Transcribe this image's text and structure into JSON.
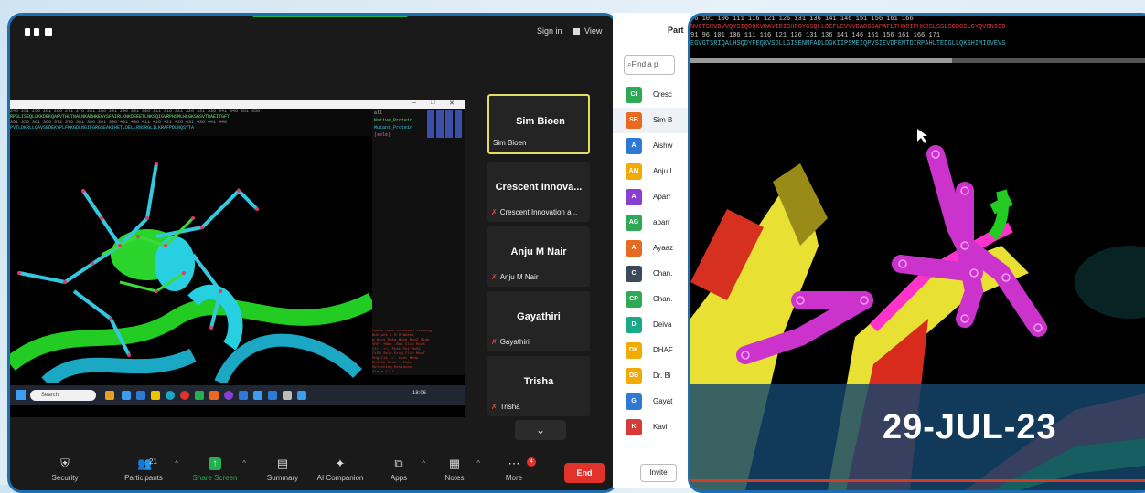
{
  "topbar": {
    "sign_in": "Sign in",
    "view": "View"
  },
  "shared_screen": {
    "seq_lines": [
      "246 251 256 261 266 271 276 281 286 291 296 301 306 311 316 321 326 331 336 341 346 351 356",
      "RPSLISEQLLKKDEKQAFVTHLTNALNKARHKEGYSFAIRLKNKDEEETLNKSQIGVRPHSMLHLGKSGSVTRAEITGFT",
      "351 356 361 366 371 376 381 386 391 396 401 406 411 416 421 426 431 436 441 446",
      "PVTLDKRLLQAVSEDEKYPLFKKGDLNGIFGRGSEAKIHETLDELLRNSRGLILKRAFPDLNQSYTA"
    ],
    "object_rows": [
      "all",
      "Native_Protein",
      "Mutant_Protein",
      "(sele)"
    ],
    "cmd_lines": [
      "Mouse Mode 3-Button Viewing",
      "Buttons L M R Wheel",
      "& Keys Rota Move MovZ Slab",
      "Shft +Box -Box Clip MovS",
      "Ctrl +/- PkAt Pk1 MvSZ",
      "CtSh Sele Orig Clip MovZ",
      "SnglClk +/- Cent Menu",
      "DblClk Menu - PkAt",
      "Selecting Residues",
      "State 1/ 1"
    ],
    "taskbar_search": "Search",
    "taskbar_clock": "18:06"
  },
  "tiles": [
    {
      "name": "Sim Bioen",
      "sub": "Sim Bioen"
    },
    {
      "name": "Crescent Innova...",
      "sub": "Crescent Innovation a..."
    },
    {
      "name": "Anju M Nair",
      "sub": "Anju M Nair"
    },
    {
      "name": "Gayathiri",
      "sub": "Gayathiri"
    },
    {
      "name": "Trisha",
      "sub": "Trisha"
    }
  ],
  "toolbar": {
    "security": "Security",
    "participants": "Participants",
    "participants_count": "21",
    "share": "Share Screen",
    "summary": "Summary",
    "ai": "AI Companion",
    "apps": "Apps",
    "notes": "Notes",
    "more": "More",
    "more_badge": "4",
    "end": "End"
  },
  "panel": {
    "title": "Part",
    "find_placeholder": "Find a p",
    "invite": "Invite",
    "participants": [
      {
        "initials": "CI",
        "name": "Cresc",
        "color": "#2eaa55"
      },
      {
        "initials": "SB",
        "name": "Sim B",
        "color": "#e86a20"
      },
      {
        "initials": "A",
        "name": "Aishw",
        "color": "#2d7ad6"
      },
      {
        "initials": "AM",
        "name": "Anju I",
        "color": "#f2a900"
      },
      {
        "initials": "A",
        "name": "Aparr",
        "color": "#8a3fd1"
      },
      {
        "initials": "AG",
        "name": "aparr",
        "color": "#2eaa55"
      },
      {
        "initials": "A",
        "name": "Ayaaz",
        "color": "#e86a20"
      },
      {
        "initials": "C",
        "name": "Chan.",
        "color": "#3a4a5c"
      },
      {
        "initials": "CP",
        "name": "Chan.",
        "color": "#2eaa55"
      },
      {
        "initials": "D",
        "name": "Deiva",
        "color": "#1aaa8a"
      },
      {
        "initials": "DK",
        "name": "DHAF",
        "color": "#f2a900"
      },
      {
        "initials": "DB",
        "name": "Dr. Bi",
        "color": "#f2a900"
      },
      {
        "initials": "G",
        "name": "Gayat",
        "color": "#2d7ad6"
      },
      {
        "initials": "K",
        "name": "Kavi",
        "color": "#d83a3a"
      }
    ]
  },
  "zoom_view": {
    "seq_lines": [
      "96   101  106  111  116  121  126  131  136  141  146  151  156  161  166",
      "NVGTSRVDVVQYSIQDQKVRAVIDIGHPGYGSQLLDEFLEVVVDADGGAPAFLTHQRIPHKRSLSSLSGDGSLGYQVSNIGD",
      "91   96   101  106  111  116  121  126  131  136  141  146  151  156  161  166  171",
      "EGVGTSRIQALHSQDYFEQKVSDLLGISENMFADLDGKIIPSMEIQPVSIEVDFEMTDIRPAHLTEDGLLQKSHIMIGVEVS"
    ],
    "date": "29-JUL-23"
  }
}
